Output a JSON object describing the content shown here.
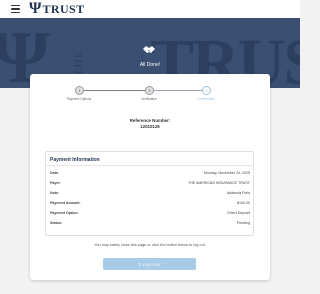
{
  "header": {
    "logo_text": "TRUST",
    "logo_mark": "Ψ"
  },
  "hero": {
    "status_text": "All Done!",
    "bg_text": "THE TRUST"
  },
  "stepper": {
    "steps": [
      {
        "label": "Payment Options",
        "state": "done"
      },
      {
        "label": "Verification",
        "state": "done"
      },
      {
        "label": "Confirmation",
        "state": "active"
      }
    ]
  },
  "reference": {
    "label": "Reference Number:",
    "value": "12010126"
  },
  "payment_info": {
    "title": "Payment Information",
    "rows": [
      {
        "key": "Date:",
        "value": "Monday, November 24, 2025"
      },
      {
        "key": "Payer:",
        "value": "THE AMERICAN INSURANCE TRUST"
      },
      {
        "key": "Note:",
        "value": "Addenda Field"
      },
      {
        "key": "Payment Amount:",
        "value": "$100.00"
      },
      {
        "key": "Payment Option:",
        "value": "Direct Deposit"
      },
      {
        "key": "Status:",
        "value": "Pending"
      }
    ]
  },
  "footer_note": "You may safely close this page or click the button below to log out.",
  "logout_button": "LOG OUT",
  "colors": {
    "brand_navy": "#1f3350",
    "hero_bg": "#3b4f72",
    "accent_light_blue": "#a8cbe8"
  }
}
